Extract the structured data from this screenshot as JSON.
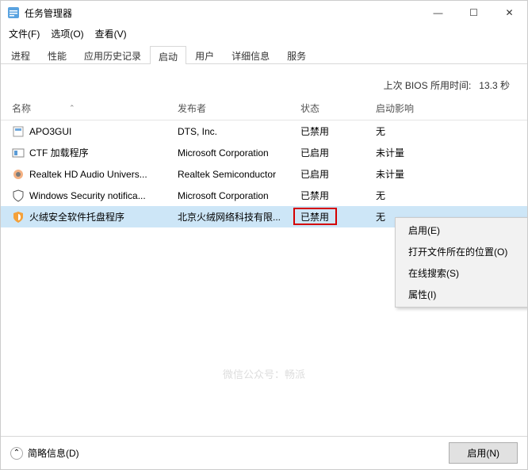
{
  "window": {
    "title": "任务管理器",
    "minimize": "—",
    "maximize": "☐",
    "close": "✕"
  },
  "menu": {
    "file": "文件(F)",
    "options": "选项(O)",
    "view": "查看(V)"
  },
  "tabs": {
    "processes": "进程",
    "performance": "性能",
    "history": "应用历史记录",
    "startup": "启动",
    "users": "用户",
    "details": "详细信息",
    "services": "服务"
  },
  "bios": {
    "label": "上次 BIOS 所用时间:",
    "value": "13.3 秒"
  },
  "columns": {
    "name": "名称",
    "publisher": "发布者",
    "status": "状态",
    "impact": "启动影响"
  },
  "rows": [
    {
      "name": "APO3GUI",
      "publisher": "DTS, Inc.",
      "status": "已禁用",
      "impact": "无"
    },
    {
      "name": "CTF 加载程序",
      "publisher": "Microsoft Corporation",
      "status": "已启用",
      "impact": "未计量"
    },
    {
      "name": "Realtek HD Audio Univers...",
      "publisher": "Realtek Semiconductor",
      "status": "已启用",
      "impact": "未计量"
    },
    {
      "name": "Windows Security notifica...",
      "publisher": "Microsoft Corporation",
      "status": "已禁用",
      "impact": "无"
    },
    {
      "name": "火绒安全软件托盘程序",
      "publisher": "北京火绒网络科技有限...",
      "status": "已禁用",
      "impact": "无"
    }
  ],
  "context": {
    "enable": "启用(E)",
    "openLocation": "打开文件所在的位置(O)",
    "searchOnline": "在线搜索(S)",
    "properties": "属性(I)"
  },
  "footer": {
    "details": "简略信息(D)",
    "button": "启用(N)"
  },
  "watermark": "微信公众号：畅派"
}
